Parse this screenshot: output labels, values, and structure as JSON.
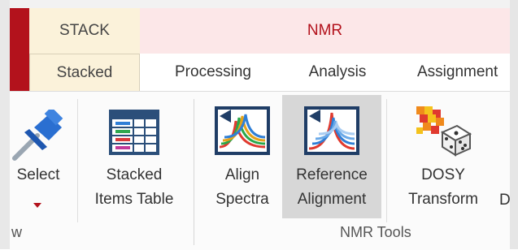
{
  "context_tabs": {
    "stack": "STACK",
    "nmr": "NMR"
  },
  "tabs": [
    {
      "label": "Stacked",
      "active": true
    },
    {
      "label": "Processing",
      "active": false
    },
    {
      "label": "Analysis",
      "active": false
    },
    {
      "label": "Assignment",
      "active": false
    }
  ],
  "ribbon": {
    "buttons": {
      "select": {
        "line1": "Select",
        "icon": "pushpin-icon"
      },
      "stacked_items": {
        "line1": "Stacked",
        "line2": "Items Table",
        "icon": "table-grid-icon"
      },
      "align": {
        "line1": "Align",
        "line2": "Spectra",
        "icon": "align-spectra-icon"
      },
      "reference": {
        "line1": "Reference",
        "line2": "Alignment",
        "icon": "reference-alignment-icon",
        "hovered": true
      },
      "dosy": {
        "line1": "DOSY",
        "line2": "Transform",
        "icon": "dosy-transform-icon"
      }
    },
    "groups": {
      "left_partial": "w",
      "nmr_tools": "NMR Tools"
    }
  },
  "colors": {
    "accent_red": "#b3121c",
    "stack_bg": "#fbf2da",
    "nmr_bg": "#fce7e8",
    "hover_bg": "#d7d7d7"
  }
}
